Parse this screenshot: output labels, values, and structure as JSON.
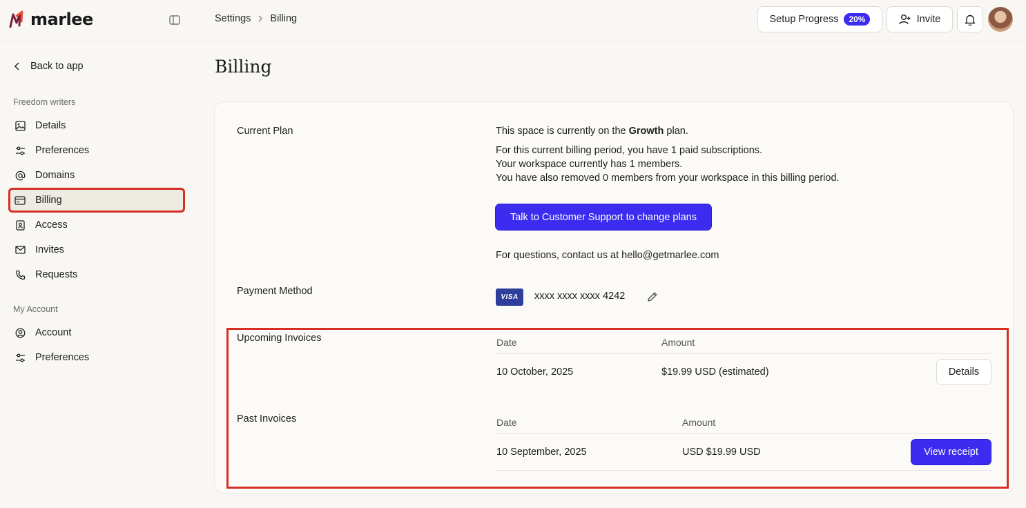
{
  "app": {
    "logo_text": "marlee"
  },
  "breadcrumb": {
    "items": [
      "Settings",
      "Billing"
    ]
  },
  "header": {
    "setup_label": "Setup Progress",
    "setup_progress": "20%",
    "invite_label": "Invite"
  },
  "sidebar": {
    "back_label": "Back to app",
    "section1_label": "Freedom writers",
    "section1_items": [
      {
        "label": "Details",
        "icon": "image-icon"
      },
      {
        "label": "Preferences",
        "icon": "sliders-icon"
      },
      {
        "label": "Domains",
        "icon": "at-icon"
      },
      {
        "label": "Billing",
        "icon": "credit-card-icon",
        "active": true
      },
      {
        "label": "Access",
        "icon": "badge-icon"
      },
      {
        "label": "Invites",
        "icon": "mail-icon"
      },
      {
        "label": "Requests",
        "icon": "phone-icon"
      }
    ],
    "section2_label": "My Account",
    "section2_items": [
      {
        "label": "Account",
        "icon": "user-circle-icon"
      },
      {
        "label": "Preferences",
        "icon": "sliders-icon"
      }
    ]
  },
  "page": {
    "title": "Billing",
    "current_plan_label": "Current Plan",
    "plan_prefix": "This space is currently on the ",
    "plan_name": "Growth",
    "plan_suffix": " plan.",
    "plan_line1": "For this current billing period, you have 1 paid subscriptions.",
    "plan_line2": "Your workspace currently has 1 members.",
    "plan_line3": "You have also removed 0 members from your workspace in this billing period.",
    "support_button": "Talk to Customer Support to change plans",
    "contact_text": "For questions, contact us at hello@getmarlee.com",
    "payment_method_label": "Payment Method",
    "card_brand": "VISA",
    "card_number": "xxxx xxxx xxxx 4242",
    "upcoming_label": "Upcoming Invoices",
    "upcoming_headers": {
      "date": "Date",
      "amount": "Amount"
    },
    "upcoming_row": {
      "date": "10 October, 2025",
      "amount": "$19.99 USD (estimated)",
      "action": "Details"
    },
    "past_label": "Past Invoices",
    "past_headers": {
      "date": "Date",
      "amount": "Amount"
    },
    "past_row": {
      "date": "10 September, 2025",
      "amount": "USD $19.99 USD",
      "action": "View receipt"
    }
  },
  "colors": {
    "accent": "#3b2cf0",
    "highlight": "#d62e22",
    "background": "#f8f7f4"
  }
}
